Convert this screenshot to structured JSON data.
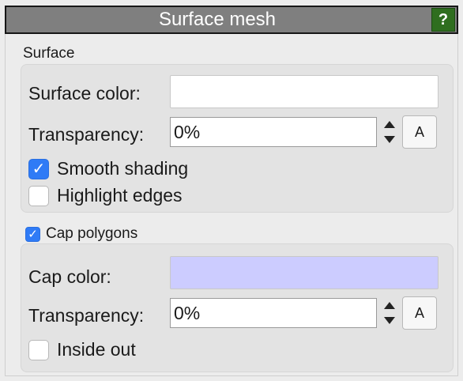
{
  "panel": {
    "title": "Surface mesh",
    "help_label": "?"
  },
  "surface": {
    "section_label": "Surface",
    "color_label": "Surface color:",
    "color_value": "#ffffff",
    "transparency_label": "Transparency:",
    "transparency_value": "0%",
    "auto_label": "A",
    "smooth_shading": {
      "label": "Smooth shading",
      "checked": true
    },
    "highlight_edges": {
      "label": "Highlight edges",
      "checked": false
    }
  },
  "cap": {
    "enabled": {
      "label": "Cap polygons",
      "checked": true
    },
    "color_label": "Cap color:",
    "color_value": "#ccccff",
    "transparency_label": "Transparency:",
    "transparency_value": "0%",
    "auto_label": "A",
    "inside_out": {
      "label": "Inside out",
      "checked": false
    }
  },
  "colors": {
    "checkbox_on": "#2f7bf6",
    "help_button": "#2f6e1f",
    "titlebar": "#7f7f7f"
  }
}
